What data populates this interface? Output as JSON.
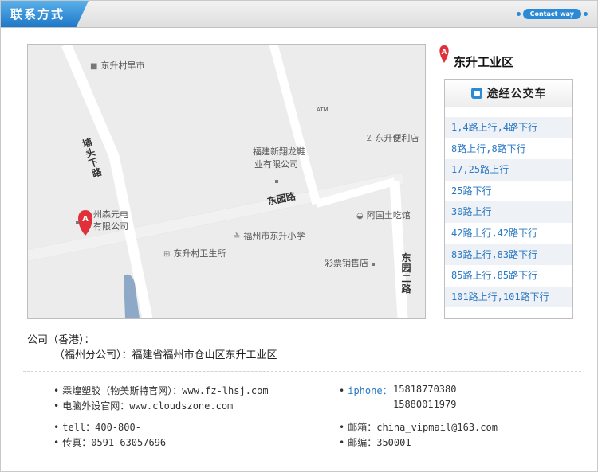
{
  "header": {
    "title": "联系方式",
    "contact_way": "Contact way"
  },
  "map": {
    "pin_label": "A",
    "pois": {
      "dongsheng_market": "东升村早市",
      "dongsheng_store": "东升便利店",
      "atm": "ATM",
      "xinxianglong_1": "福建新翔龙鞋",
      "xinxianglong_2": "业有限公司",
      "senyuan_1": "州森元电",
      "senyuan_2": "有限公司",
      "aguo": "阿国土吃馆",
      "school": "福州市东升小学",
      "clinic": "东升村卫生所",
      "lottery": "彩票销售店"
    },
    "roads": {
      "putou": "埔头下路",
      "dongyuan": "东园路",
      "dongyuan2": "东园二路"
    }
  },
  "location": {
    "name": "东升工业区"
  },
  "bus": {
    "title": "途经公交车",
    "routes": [
      "1,4路上行,4路下行",
      "8路上行,8路下行",
      "17,25路上行",
      "25路下行",
      "30路上行",
      "42路上行,42路下行",
      "83路上行,83路下行",
      "85路上行,85路下行",
      "101路上行,101路下行"
    ]
  },
  "address": {
    "line1": "公司（香港）：",
    "line2": "（福州分公司）：福建省福州市仓山区东升工业区"
  },
  "contacts": {
    "website1": "霖煌塑胶（物美斯特官网）：www.fz-lhsj.com",
    "website2": "电脑外设官网：www.cloudszone.com",
    "iphone_label": "iphone：",
    "iphone1": "15818770380",
    "iphone2": "15880011979",
    "tell": "tell：400-800-",
    "fax": "传真：0591-63057696",
    "email": "邮箱：china_vipmail@163.com",
    "postcode": "邮编：350001",
    "bullet": "•"
  }
}
